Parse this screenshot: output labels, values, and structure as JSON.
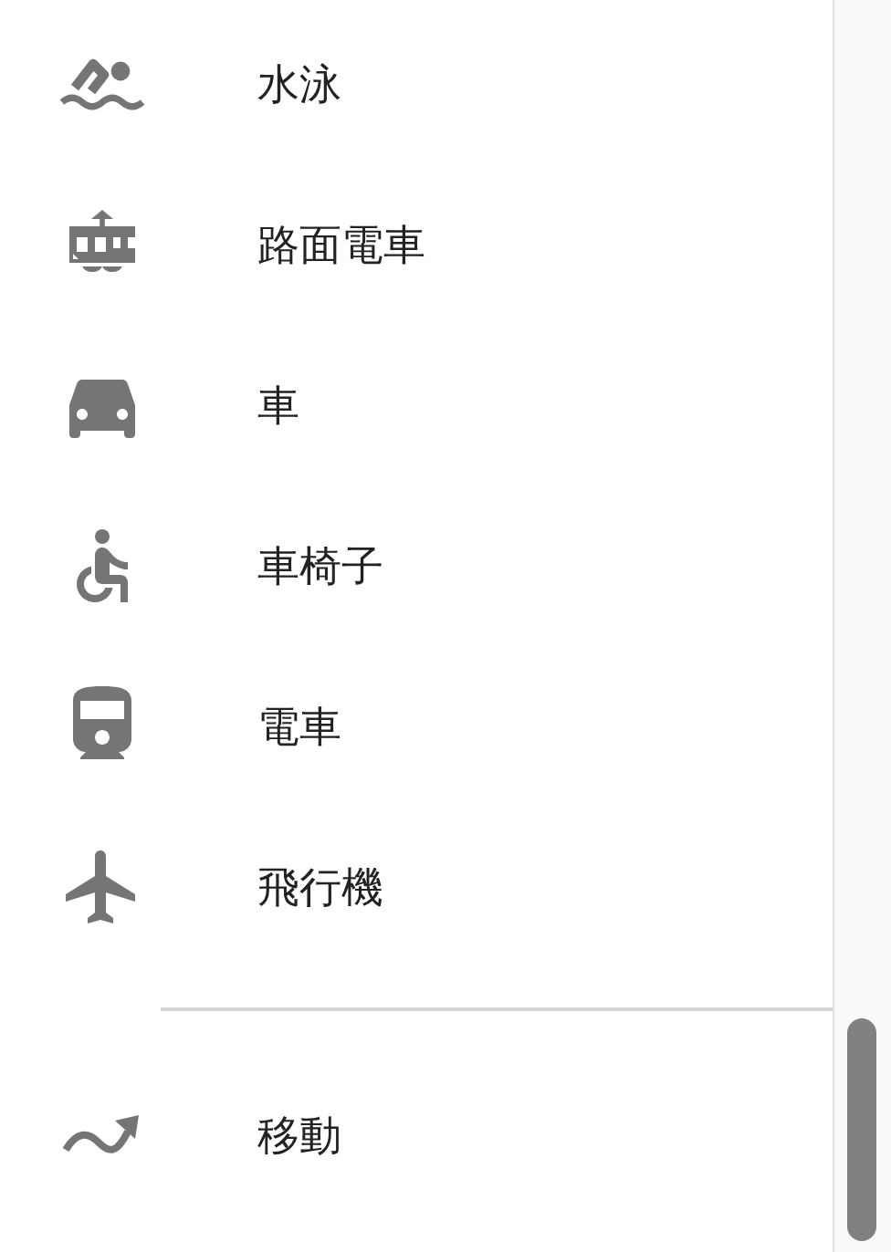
{
  "groups": [
    {
      "items": [
        {
          "label": "水泳"
        },
        {
          "label": "路面電車"
        },
        {
          "label": "車"
        },
        {
          "label": "車椅子"
        },
        {
          "label": "電車"
        },
        {
          "label": "飛行機"
        }
      ]
    },
    {
      "items": [
        {
          "label": "移動"
        }
      ]
    }
  ]
}
